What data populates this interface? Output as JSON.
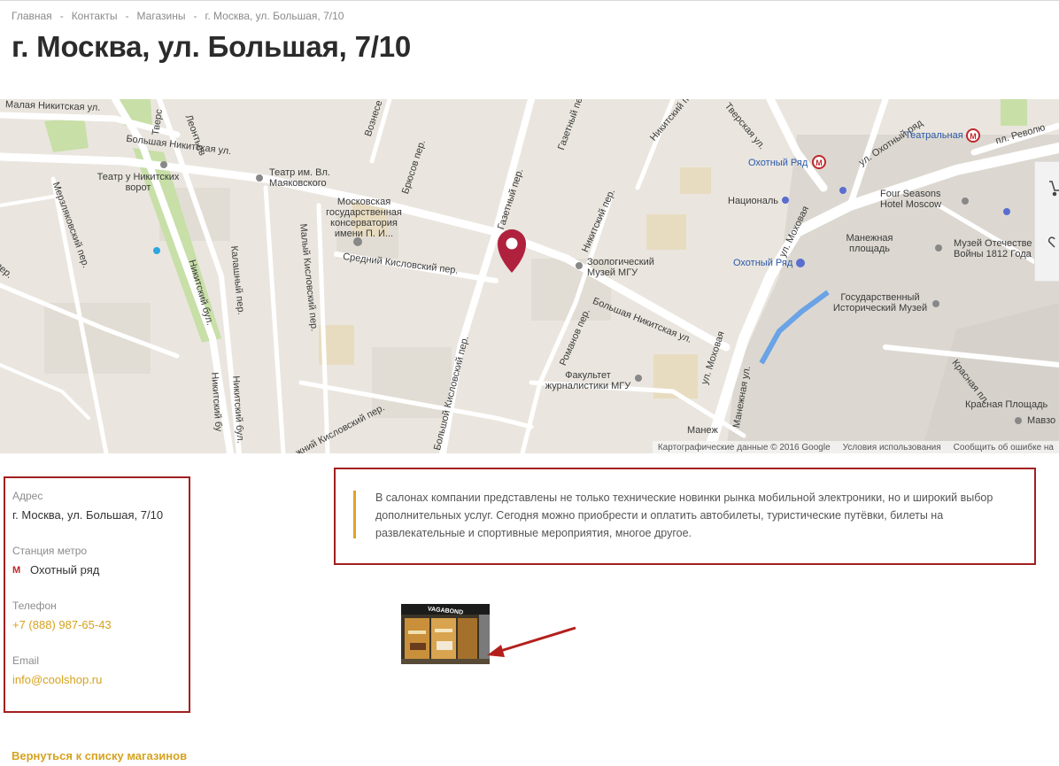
{
  "breadcrumb": [
    "Главная",
    "Контакты",
    "Магазины",
    "г. Москва, ул. Большая, 7/10"
  ],
  "page_title": "г. Москва, ул. Большая, 7/10",
  "map": {
    "streets": {
      "malaya_nikitskaya": "Малая Никитская ул.",
      "bolshaya_nikitskaya_1": "Большая Никитская ул.",
      "bolshaya_nikitskaya_2": "Большая Никитская ул.",
      "leontievsky": "Леонтьев",
      "voznesensky": "Вознесе",
      "bryusov": "Брюсов пер.",
      "gazetny_1": "Газетный пер.",
      "gazetny_2": "Газетный пер.",
      "nikitsky_per": "Никитский пер.",
      "nikitsky_per_top": "Никитский пер.",
      "tverskaya": "Тверская ул.",
      "tverskaya_left": "Тверс",
      "okhotny_ryad_ul": "ул. Охотный ряд",
      "revolyutsii": "пл. Револю",
      "merzlyakovsky": "Мерзляковский пер.",
      "malyy_kislovsky": "Малый Кисловский пер.",
      "sredniy_kislovsky": "Средний Кисловский пер.",
      "kalashny": "Калашный пер.",
      "nikitsky_bulvar_1": "Никитский бул.",
      "nikitsky_bulvar_2": "Никитский бул.",
      "nikitsky_bulvar_3": "Никитский бу",
      "bolshoy_kislovsky": "Большой Кисловский пер.",
      "nizhny_kislovsky": "жний Кисловский пер.",
      "romanov": "Романов пер.",
      "mokhovaya_1": "ул. Моховая",
      "mokhovaya_2": "ул. Моховая",
      "manezhnaya_ul": "Манежная ул.",
      "krasnaya_pl": "Красная пл.",
      "left_per": "пер."
    },
    "places": {
      "teatr_nikitskikh": "Театр у Никитских ворот",
      "teatr_mayakovskogo": "Театр им. Вл. Маяковского",
      "konservatoriya": "Московская государственная консерватория имени П. И...",
      "zoo_muzey": "Зоологический Музей МГУ",
      "fakultet": "Факультет журналистики МГУ",
      "natsional": "Националь",
      "four_seasons": "Four Seasons Hotel Moscow",
      "manezhnaya_pl": "Манежная площадь",
      "istorichesky": "Государственный Исторический Музей",
      "muzey_1812": "Музей Отечестве Войны 1812 Года",
      "manezh": "Манеж",
      "krasnaya_ploshchad": "Красная Площадь",
      "mavzoley": "Мавзо"
    },
    "metro": {
      "teatralnaya": "Театральная",
      "okhotny_ryad": "Охотный Ряд",
      "okhotny_ryad_2": "Охотный Ряд"
    },
    "attribution": [
      "Картографические данные © 2016 Google",
      "Условия использования",
      "Сообщить об ошибке на"
    ],
    "colors": {
      "background": "#eae6df",
      "road": "#ffffff",
      "park": "#c8dfa8",
      "water": "#6aa3e6",
      "pin": "#b0213e"
    }
  },
  "info": {
    "address_label": "Адрес",
    "address_value": "г. Москва, ул. Большая, 7/10",
    "metro_label": "Станция метро",
    "metro_icon": "М",
    "metro_value": "Охотный ряд",
    "phone_label": "Телефон",
    "phone_value": "+7 (888) 987-65-43",
    "email_label": "Email",
    "email_value": "info@coolshop.ru"
  },
  "description": "В салонах компании представлены не только технические новинки рынка мобильной электроники, но и широкий выбор дополнительных услуг. Сегодня можно приобрести и оплатить автобилеты, туристические путёвки, билеты на развлекательные и спортивные мероприятия, многое другое.",
  "photo": {
    "sign_text": "VAGABOND"
  },
  "back_link": "Вернуться к списку магазинов",
  "colors": {
    "accent": "#d6a21e",
    "highlight_border": "#a31f1f",
    "quote_bar": "#e3a22a",
    "arrow": "#b3201c"
  }
}
